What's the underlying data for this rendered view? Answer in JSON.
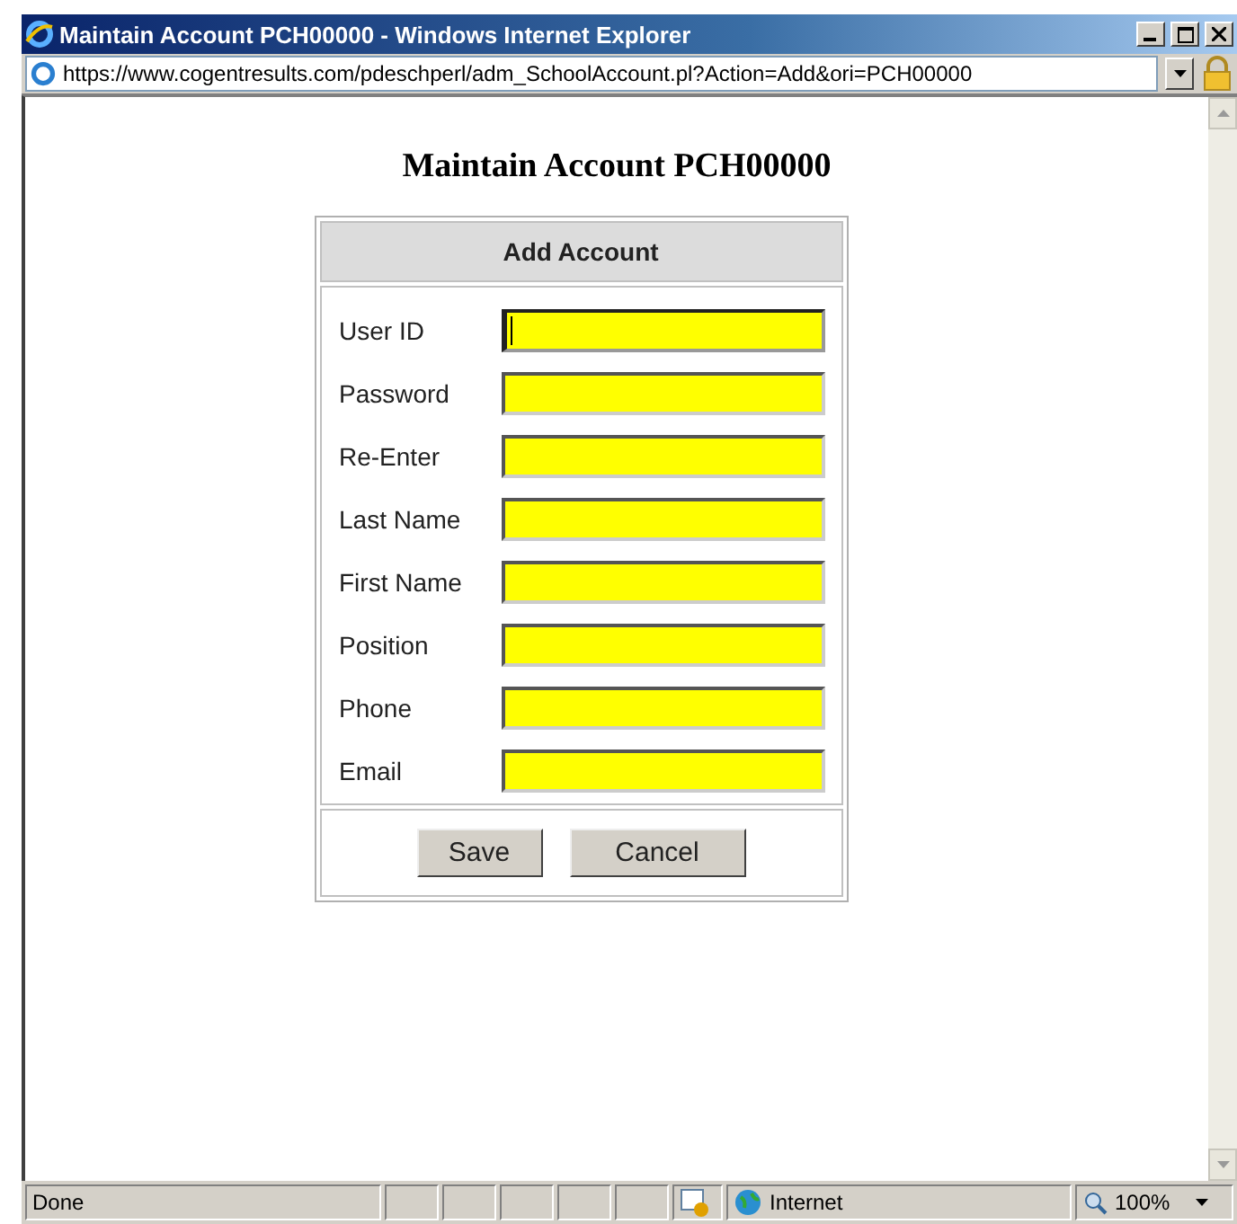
{
  "window": {
    "title": "Maintain Account PCH00000 - Windows Internet Explorer"
  },
  "address_bar": {
    "url": "https://www.cogentresults.com/pdeschperl/adm_SchoolAccount.pl?Action=Add&ori=PCH00000"
  },
  "page": {
    "heading": "Maintain Account PCH00000",
    "form": {
      "title": "Add Account",
      "fields": [
        {
          "label": "User ID",
          "focused": true
        },
        {
          "label": "Password",
          "focused": false
        },
        {
          "label": "Re-Enter",
          "focused": false
        },
        {
          "label": "Last Name",
          "focused": false
        },
        {
          "label": "First Name",
          "focused": false
        },
        {
          "label": "Position",
          "focused": false
        },
        {
          "label": "Phone",
          "focused": false
        },
        {
          "label": "Email",
          "focused": false
        }
      ],
      "buttons": [
        "Save",
        "Cancel"
      ]
    }
  },
  "status_bar": {
    "status": "Done",
    "zone": "Internet",
    "zoom": "100%"
  }
}
